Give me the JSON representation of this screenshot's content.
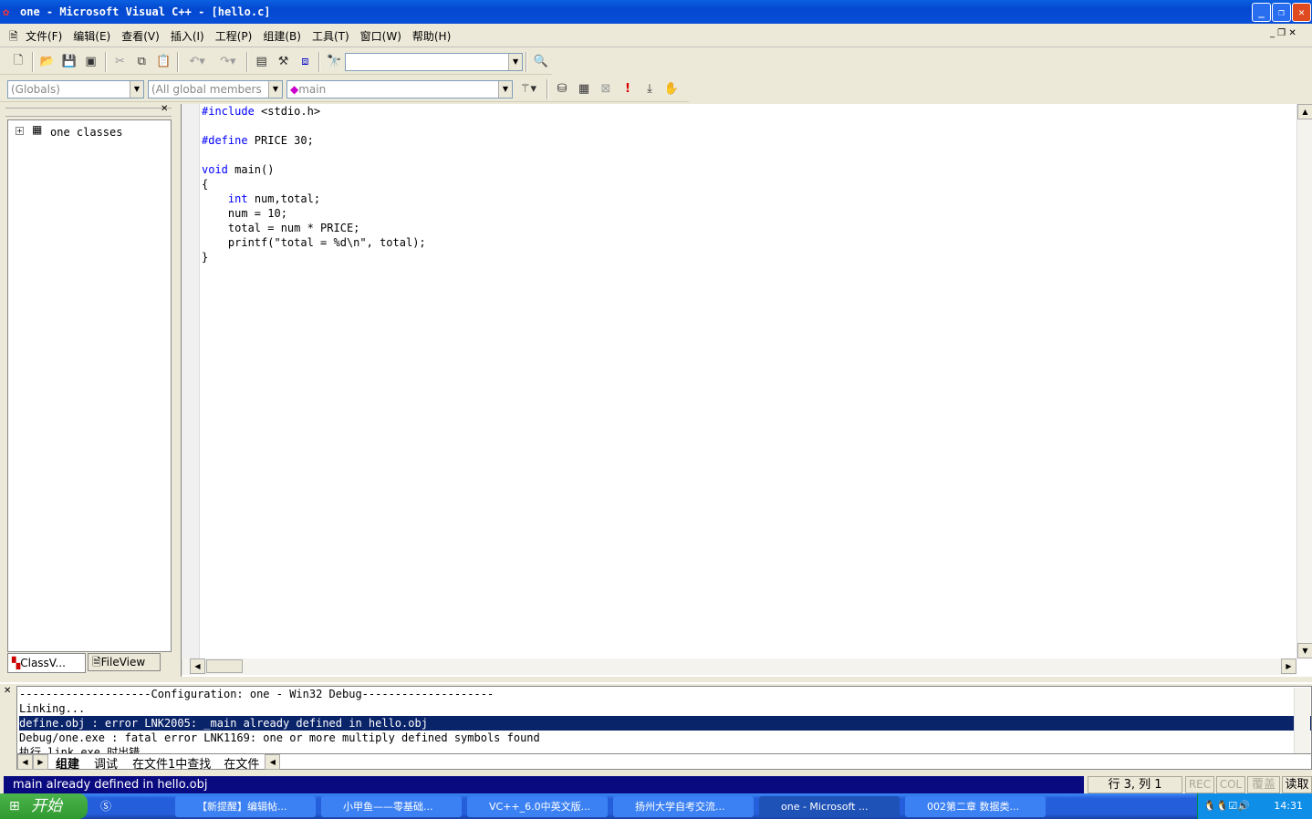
{
  "window": {
    "title": "one - Microsoft Visual C++ - [hello.c]"
  },
  "menu": [
    "文件(F)",
    "编辑(E)",
    "查看(V)",
    "插入(I)",
    "工程(P)",
    "组建(B)",
    "工具(T)",
    "窗口(W)",
    "帮助(H)"
  ],
  "toolbar": {
    "find_value": ""
  },
  "wizardbar": {
    "class": "(Globals)",
    "filter": "(All global members",
    "member": "main"
  },
  "workspace": {
    "tree_root": "one classes",
    "tabs": [
      "ClassV...",
      "FileView"
    ]
  },
  "editor": {
    "lines": [
      [
        [
          "kw",
          "#include"
        ],
        [
          "t",
          " <stdio.h>"
        ]
      ],
      [],
      [
        [
          "kw",
          "#define"
        ],
        [
          "t",
          " PRICE 30;"
        ]
      ],
      [],
      [
        [
          "kw",
          "void"
        ],
        [
          "t",
          " main()"
        ]
      ],
      [
        [
          "t",
          "{"
        ]
      ],
      [
        [
          "t",
          "    "
        ],
        [
          "kw",
          "int"
        ],
        [
          "t",
          " num,total;"
        ]
      ],
      [
        [
          "t",
          "    num = 10;"
        ]
      ],
      [
        [
          "t",
          "    total = num * PRICE;"
        ]
      ],
      [
        [
          "t",
          "    printf(\"total = %d\\n\", total);"
        ]
      ],
      [
        [
          "t",
          "}"
        ]
      ]
    ]
  },
  "output": {
    "lines": [
      "--------------------Configuration: one - Win32 Debug--------------------",
      "Linking...",
      "define.obj : error LNK2005: _main already defined in hello.obj",
      "Debug/one.exe : fatal error LNK1169: one or more multiply defined symbols found",
      "执行 link.exe 时出错."
    ],
    "selected_line": 2,
    "tabs": [
      "组建",
      "调试",
      "在文件1中查找",
      "在文件"
    ]
  },
  "statusbar": {
    "message": "main already defined in hello.obj",
    "position": "行 3, 列 1",
    "rec": "REC",
    "col": "COL",
    "ovr": "覆盖",
    "read": "读取"
  },
  "taskbar": {
    "start": "开始",
    "tasks": [
      "【新提醒】编辑帖...",
      "小甲鱼——零基础...",
      "VC++_6.0中英文版...",
      "扬州大学自考交流...",
      "one - Microsoft ...",
      "002第二章 数据类..."
    ],
    "active_task": 4,
    "clock": "14:31"
  },
  "colors": {
    "title_blue": "#0a4fd8",
    "selection": "#0a246a",
    "keyword": "#0000ff"
  }
}
